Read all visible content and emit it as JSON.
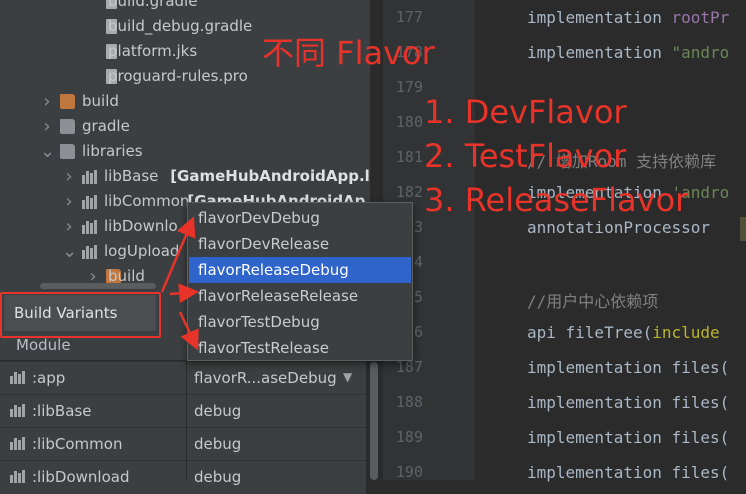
{
  "project_tree": {
    "items": [
      {
        "label": "build.gradle",
        "indent": 3,
        "icon": "gradle-file-icon"
      },
      {
        "label": "build_debug.gradle",
        "indent": 3,
        "icon": "gradle-file-icon"
      },
      {
        "label": "platform.jks",
        "indent": 3,
        "icon": "file-icon"
      },
      {
        "label": "proguard-rules.pro",
        "indent": 3,
        "icon": "file-icon"
      },
      {
        "label": "build",
        "indent": 1,
        "icon": "folder-orange-icon",
        "chevron": ">"
      },
      {
        "label": "gradle",
        "indent": 1,
        "icon": "folder-icon",
        "chevron": ">"
      },
      {
        "label": "libraries",
        "indent": 1,
        "icon": "folder-icon",
        "chevron": "v"
      },
      {
        "label": "libBase",
        "suffix": "[GameHubAndroidApp.li",
        "indent": 2,
        "icon": "library-icon",
        "chevron": ">"
      },
      {
        "label": "libCommon",
        "suffix": "[GameHubAndroidAp",
        "indent": 2,
        "icon": "library-icon",
        "chevron": ">"
      },
      {
        "label": "libDownlo",
        "indent": 2,
        "icon": "library-icon",
        "chevron": ">"
      },
      {
        "label": "logUpload",
        "indent": 2,
        "icon": "library-icon",
        "chevron": "v"
      },
      {
        "label": "build",
        "indent": 3,
        "icon": "folder-orange-icon",
        "chevron": ">"
      }
    ]
  },
  "editor": {
    "line_numbers": [
      "177",
      "178",
      "179",
      "180",
      "181",
      "182",
      "183",
      "184",
      "185",
      "186",
      "187",
      "188",
      "189",
      "190"
    ],
    "lines": [
      [
        {
          "t": "implementation ",
          "c": "plain"
        },
        {
          "t": "rootPr",
          "c": "var"
        }
      ],
      [
        {
          "t": "implementation ",
          "c": "plain"
        },
        {
          "t": "\"andro",
          "c": "str"
        }
      ],
      [],
      [],
      [
        {
          "t": "// 增加Room 支持依赖库",
          "c": "cm"
        }
      ],
      [
        {
          "t": "implementation ",
          "c": "plain"
        },
        {
          "t": "'andro",
          "c": "str"
        }
      ],
      [
        {
          "t": "annotationProcessor ",
          "c": "plain"
        }
      ],
      [],
      [
        {
          "t": "//用户中心依赖项",
          "c": "cm"
        }
      ],
      [
        {
          "t": "api ",
          "c": "plain"
        },
        {
          "t": "fileTree(",
          "c": "plain"
        },
        {
          "t": "include",
          "c": "anno"
        }
      ],
      [
        {
          "t": "implementation files(",
          "c": "plain"
        }
      ],
      [
        {
          "t": "implementation files(",
          "c": "plain"
        }
      ],
      [
        {
          "t": "implementation files(",
          "c": "plain"
        }
      ],
      [
        {
          "t": "implementation files(",
          "c": "plain"
        }
      ]
    ]
  },
  "build_variants": {
    "tab_label": "Build Variants",
    "column_module": "Module",
    "rows": [
      {
        "module": ":app",
        "variant": "flavorR...aseDebug",
        "has_dropdown": true
      },
      {
        "module": ":libBase",
        "variant": "debug"
      },
      {
        "module": ":libCommon",
        "variant": "debug"
      },
      {
        "module": ":libDownload",
        "variant": "debug"
      }
    ]
  },
  "variant_dropdown": {
    "options": [
      "flavorDevDebug",
      "flavorDevRelease",
      "flavorReleaseDebug",
      "flavorReleaseRelease",
      "flavorTestDebug",
      "flavorTestRelease"
    ],
    "selected_index": 2
  },
  "annotations": {
    "title": "不同 Flavor",
    "items": [
      "1. DevFlavor",
      "2. TestFlavor",
      "3. ReleaseFlavor"
    ]
  },
  "colors": {
    "annotation_red": "#e8332a",
    "selection_blue": "#2f65ca",
    "panel_bg": "#3c3f41",
    "editor_bg": "#2b2b2b"
  }
}
